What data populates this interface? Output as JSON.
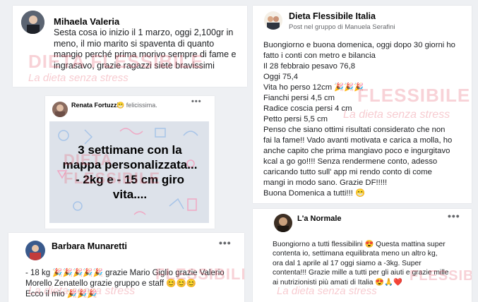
{
  "posts": {
    "mihaela": {
      "name": "Mihaela Valeria",
      "text": "Sesta cosa io inizio il 1 marzo, oggi 2,100gr in meno, il mio marito si spaventa di quanto mangio perché prima morivo sempre di fame e ingrasavo, grazie ragazzi siete bravissimi"
    },
    "renata": {
      "name": "Renata Fortuzzi",
      "feeling": "😁 felicissima.",
      "image_text": "3 settimane con la mappa personalizzata...      - 2kg e - 15 cm giro vita...."
    },
    "barbara": {
      "name": "Barbara Munaretti",
      "lines": [
        "- 18 kg 🎉🎉🎉🎉🎉 grazie Mario Giglio  grazie Valerio",
        "Morello Zenatello  grazie gruppo e staff 😊😊😊",
        "Ecco il mio 🎉🎉🎉"
      ]
    },
    "dieta": {
      "name": "Dieta Flessibile Italia",
      "subtitle": "Post nel gruppo di Manuela Serafini",
      "lines": [
        "Buongiorno e buona domenica, oggi dopo 30 giorni ho",
        "fatto i conti con metro e bilancia",
        "Il 28 febbraio pesavo 76,8",
        " Oggi 75,4",
        "Vita ho perso 12cm 🎉🎉🎉",
        "Fianchi persi 4,5 cm",
        "Radice coscia persi 4 cm",
        "Petto persi 5,5 cm",
        "Penso che siano ottimi risultati considerato che non",
        "fai la fame!! Vado avanti motivata e carica a molla, ho",
        "anche capito che prima mangiavo poco e ingurgitavo",
        "kcal a go go!!!! Senza rendermene conto, adesso",
        "caricando tutto sull' app mi rendo conto  di come",
        "mangi in modo sano. Grazie DF!!!!!",
        "Buona Domenica a tutti!!! 😁"
      ]
    },
    "normale": {
      "name": "L'a Normale",
      "lines": [
        "Buongiorno a tutti flessibilini 😍 Questa mattina super",
        "contenta io, settimana equilibrata meno un altro kg,",
        "ora dal 1 aprile al 17 oggi siamo a -3kg. Super",
        "contenta!!! Grazie mille a tutti per gli aiuti e grazie mille",
        "ai nutrizionisti più amati di Italia 😍🙏❤️"
      ]
    }
  },
  "watermark": {
    "brand": "DIETA FLESSIBILE",
    "brand_short": "FLESSIBILE",
    "tagline": "La dieta senza stress"
  },
  "icons": {
    "more": "more-options-icon"
  },
  "colors": {
    "watermark": "#e75c6e",
    "image_bg": "#dde2ea"
  }
}
